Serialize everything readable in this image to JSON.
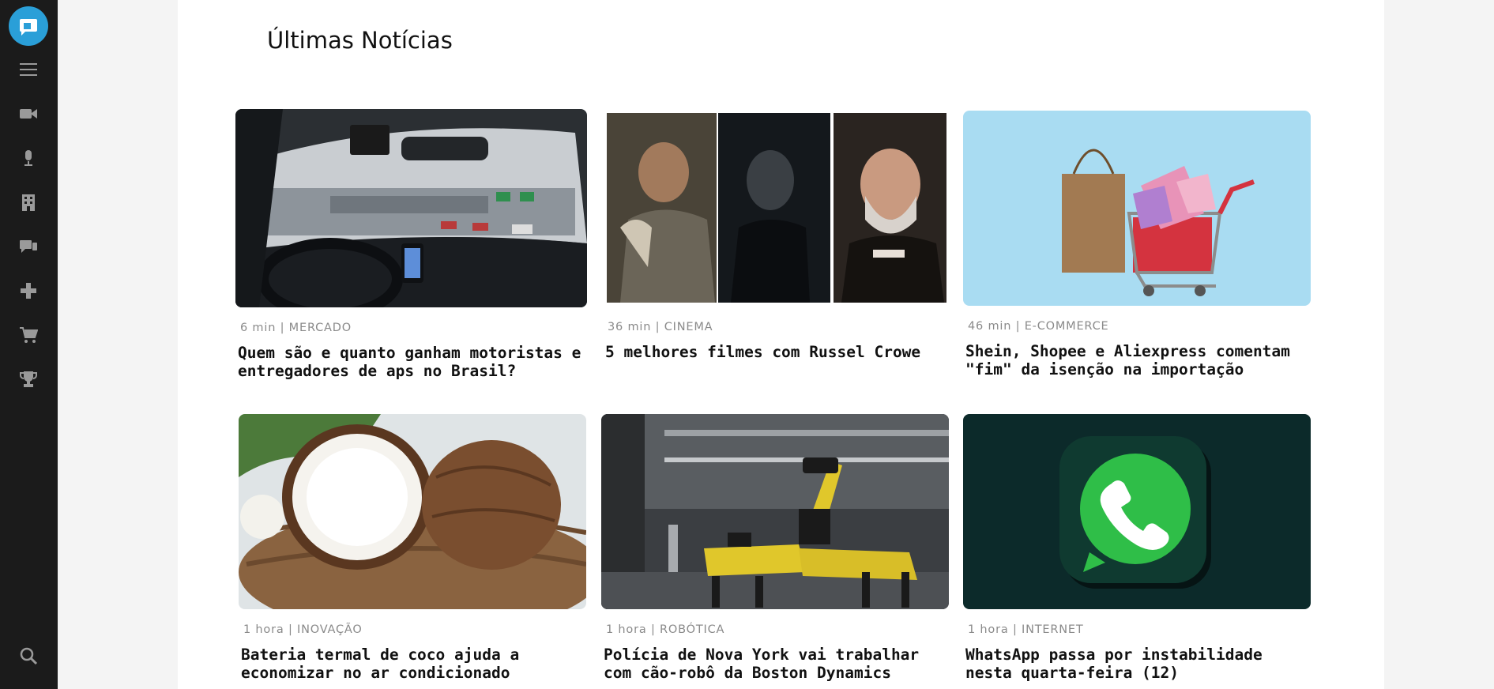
{
  "sidebar": {
    "logo_icon": "logo-icon",
    "items": [
      {
        "name": "menu-icon"
      },
      {
        "name": "video-camera-icon"
      },
      {
        "name": "microphone-icon"
      },
      {
        "name": "building-icon"
      },
      {
        "name": "chat-bubbles-icon"
      },
      {
        "name": "plus-icon"
      },
      {
        "name": "shopping-cart-icon"
      },
      {
        "name": "trophy-icon"
      },
      {
        "name": "search-icon"
      }
    ]
  },
  "section": {
    "title": "Últimas Notícias"
  },
  "articles": [
    {
      "meta": "6 min | MERCADO",
      "title": "Quem são e quanto ganham motoristas e entregadores de aps no Brasil?",
      "image": "car-dashboard-traffic-photo"
    },
    {
      "meta": "36 min | CINEMA",
      "title": "5 melhores filmes com Russel Crowe",
      "image": "actor-portraits-collage"
    },
    {
      "meta": "46 min | E-COMMERCE",
      "title": "Shein, Shopee e Aliexpress comentam \"fim\" da isenção na importação",
      "image": "shopping-bag-cart-photo"
    },
    {
      "meta": "1 hora | INOVAÇÃO",
      "title": "Bateria termal de coco ajuda a economizar no ar condicionado",
      "image": "coconut-halves-photo"
    },
    {
      "meta": "1 hora | ROBÓTICA",
      "title": "Polícia de Nova York vai trabalhar com cão-robô da Boston Dynamics",
      "image": "yellow-robot-dog-photo"
    },
    {
      "meta": "1 hora | INTERNET",
      "title": "WhatsApp passa por instabilidade nesta quarta-feira (12)",
      "image": "whatsapp-logo-photo"
    }
  ],
  "colors": {
    "sidebar_bg": "#1b1b1b",
    "logo_accent": "#2a9fd8",
    "page_bg": "#f4f4f4",
    "content_bg": "#ffffff",
    "meta_text": "#8a8a8a"
  }
}
